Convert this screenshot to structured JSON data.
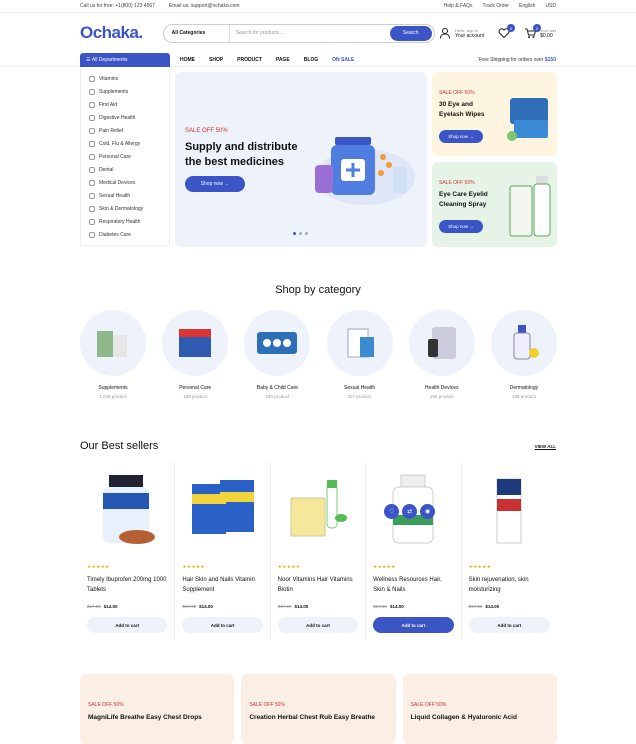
{
  "topbar": {
    "phone": "Call us for free: +1(800) 123 4567",
    "email": "Email us: support@ochaka.com",
    "help": "Help & FAQs",
    "track": "Track Order",
    "lang": "English",
    "currency": "USD"
  },
  "header": {
    "logo": "Ochaka.",
    "search_cat": "All Categories",
    "search_ph": "Search for products...",
    "search_btn": "Search",
    "acct_top": "Hello, sign in",
    "acct_bottom": "Your account",
    "wish_count": "0",
    "cart_count": "0",
    "cart_label": "Your cart",
    "cart_total": "$0.00"
  },
  "nav": {
    "dept": "All Departments",
    "menu": [
      "HOME",
      "SHOP",
      "PRODUCT",
      "PAGE",
      "BLOG",
      "ON SALE"
    ],
    "ship_pre": "Free Shipping for orders over ",
    "ship_amt": "$150"
  },
  "departments": [
    "Vitamins",
    "Supplements",
    "First Aid",
    "Digestive Health",
    "Pain Relief",
    "Cold, Flu & Allergy",
    "Personal Care",
    "Dental",
    "Medical Devices",
    "Sexual Health",
    "Skin & Dermatology",
    "Respiratory Health",
    "Diabetes Care"
  ],
  "hero": {
    "sale": "SALE OFF 50%",
    "title": "Supply and distribute the best medicines",
    "btn": "Shop now"
  },
  "side1": {
    "sale": "SALE OFF 50%",
    "title": "30 Eye and Eyelash Wipes",
    "btn": "Shop now"
  },
  "side2": {
    "sale": "SALE OFF 50%",
    "title": "Eye Care Eyelid Cleaning Spray",
    "btn": "Shop now"
  },
  "categories_title": "Shop by category",
  "categories": [
    {
      "name": "Supplements",
      "count": "1,246 product"
    },
    {
      "name": "Personal Care",
      "count": "189 product"
    },
    {
      "name": "Baby & Child Care",
      "count": "240 product"
    },
    {
      "name": "Sexual Health",
      "count": "327 product"
    },
    {
      "name": "Health Devices",
      "count": "195 product"
    },
    {
      "name": "Dermatology",
      "count": "188 product"
    }
  ],
  "bestsellers": {
    "title": "Our Best sellers",
    "viewall": "VIEW ALL"
  },
  "products": [
    {
      "name": "Timely Ibuprofen 200mg 1000 Tablets",
      "old": "$17.00",
      "price": "$14.00",
      "cart": "Add to cart"
    },
    {
      "name": "Hair Skin and Nails Vitamin Supplement",
      "old": "$17.00",
      "price": "$14.00",
      "cart": "Add to cart"
    },
    {
      "name": "Noor Vitamins Hair Vitamins Biotin",
      "old": "$17.00",
      "price": "$14.00",
      "cart": "Add to cart"
    },
    {
      "name": "Wellness Resources Hair, Skin & Nails",
      "old": "$17.00",
      "price": "$14.00",
      "cart": "Add to cart"
    },
    {
      "name": "Skin rejuvenation, skin moisturizing",
      "old": "$17.00",
      "price": "$14.00",
      "cart": "Add to cart"
    }
  ],
  "promos": [
    {
      "sale": "SALE OFF 50%",
      "title": "MagniLife Breathe Easy Chest Drops"
    },
    {
      "sale": "SALE OFF 50%",
      "title": "Creation Herbal Chest Rub Easy Breathe"
    },
    {
      "sale": "SALE OFF 50%",
      "title": "Liquid Collagen & Hyaluronic Acid"
    }
  ],
  "colors": {
    "accent": "#3b55c7",
    "sale": "#cc3333"
  }
}
